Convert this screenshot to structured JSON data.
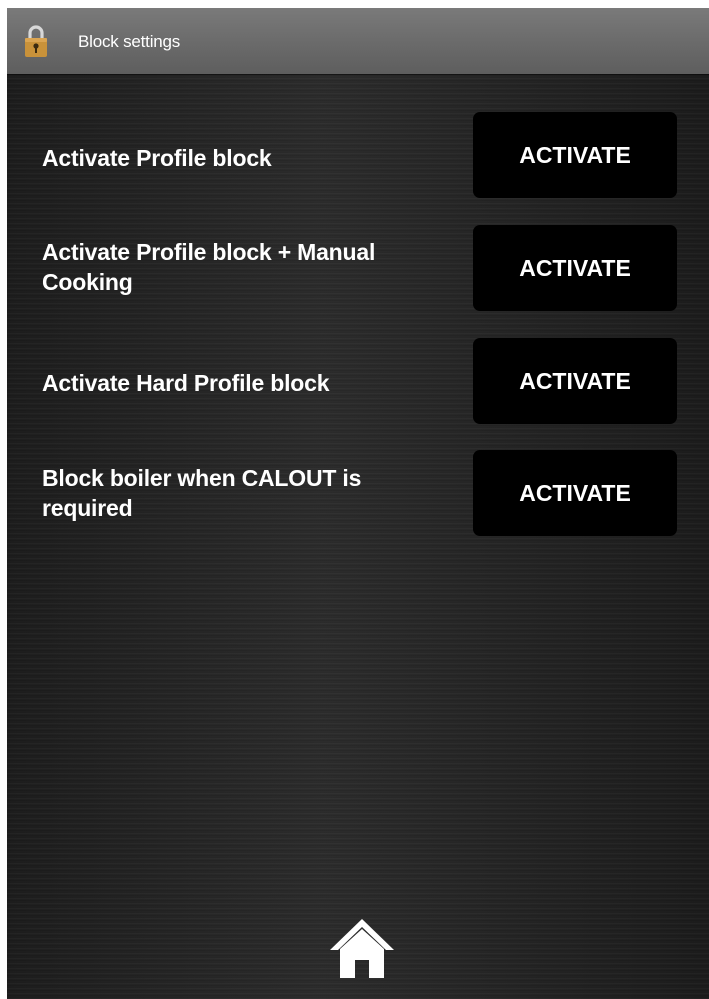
{
  "header": {
    "title": "Block settings",
    "icon": "lock-icon"
  },
  "settings": [
    {
      "label": "Activate Profile block",
      "button_label": "ACTIVATE"
    },
    {
      "label": "Activate Profile block + Manual Cooking",
      "button_label": "ACTIVATE"
    },
    {
      "label": "Activate Hard Profile block",
      "button_label": "ACTIVATE"
    },
    {
      "label": "Block boiler when CALOUT is required",
      "button_label": "ACTIVATE"
    }
  ],
  "footer": {
    "icon": "home-icon"
  },
  "colors": {
    "titlebar": "#6e6e6e",
    "background": "#222222",
    "button": "#000000",
    "text": "#ffffff",
    "lock_body": "#c9923a"
  }
}
